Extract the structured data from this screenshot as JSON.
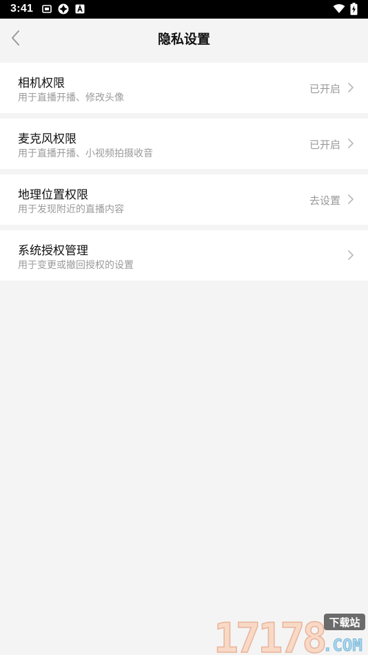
{
  "status_bar": {
    "time": "3:41",
    "icons": [
      "sim-icon",
      "app-notification-icon",
      "a-badge-icon",
      "wifi-icon",
      "battery-charging-icon"
    ]
  },
  "header": {
    "title": "隐私设置",
    "back_icon": "back-chevron-icon"
  },
  "settings": [
    {
      "title": "相机权限",
      "subtitle": "用于直播开播、修改头像",
      "status": "已开启"
    },
    {
      "title": "麦克风权限",
      "subtitle": "用于直播开播、小视频拍摄收音",
      "status": "已开启"
    },
    {
      "title": "地理位置权限",
      "subtitle": "用于发现附近的直播内容",
      "status": "去设置"
    },
    {
      "title": "系统授权管理",
      "subtitle": "用于变更或撤回授权的设置",
      "status": ""
    }
  ],
  "watermark": {
    "number": "17178",
    "badge": "下载站",
    "suffix": ".COM"
  },
  "colors": {
    "background": "#f4f4f4",
    "card": "#ffffff",
    "title_text": "#111111",
    "secondary_text": "#9a9a9a",
    "status_bar": "#000000"
  }
}
